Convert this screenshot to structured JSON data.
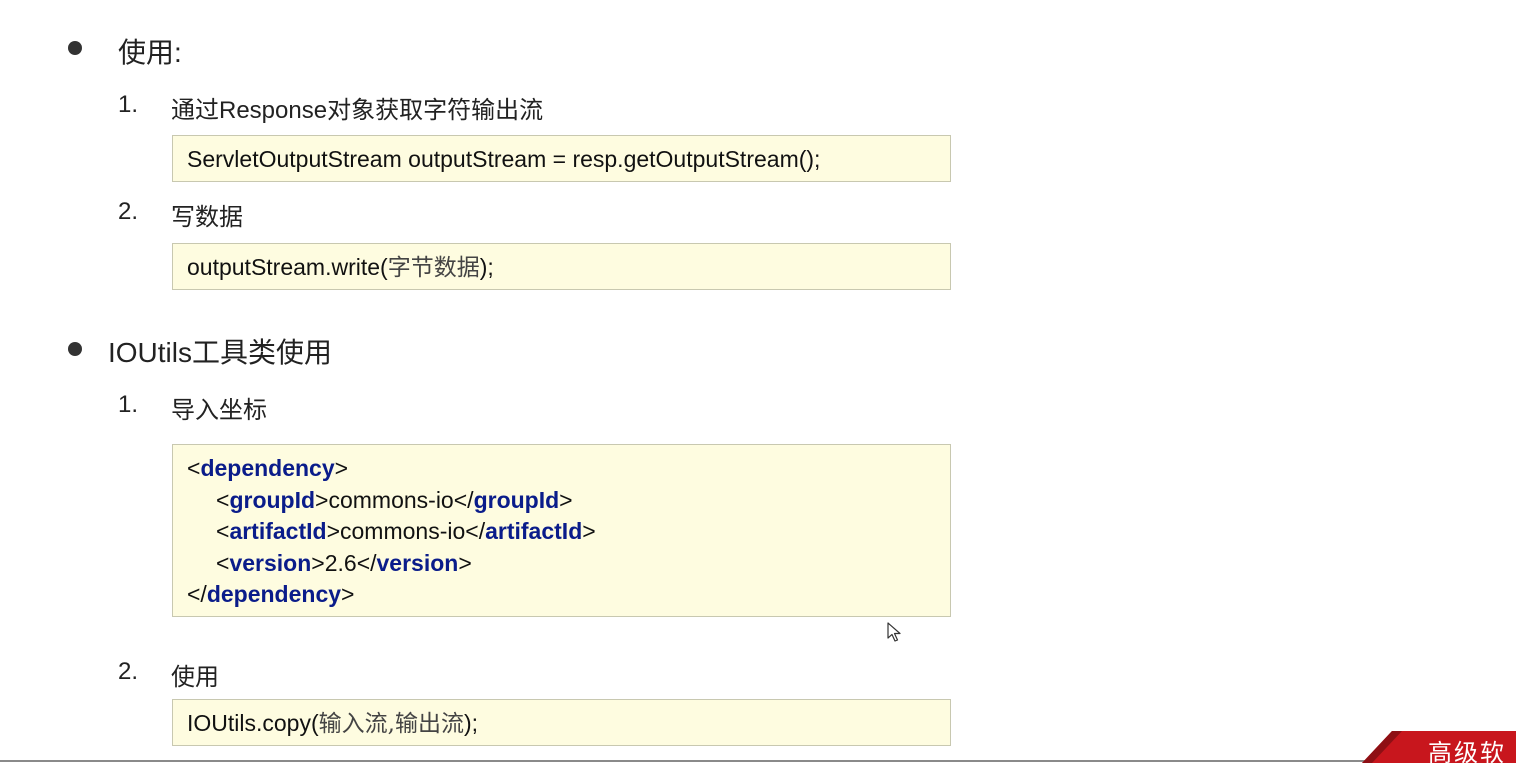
{
  "sections": [
    {
      "title": "使用:",
      "steps": [
        {
          "num": "1.",
          "label": "通过Response对象获取字符输出流",
          "code": "ServletOutputStream outputStream = resp.getOutputStream();"
        },
        {
          "num": "2.",
          "label": "写数据",
          "code_prefix": "outputStream.write(",
          "code_cn": "字节数据",
          "code_suffix": ");"
        }
      ]
    },
    {
      "title": "IOUtils工具类使用",
      "steps": [
        {
          "num": "1.",
          "label": "导入坐标",
          "xml": {
            "root_tag": "dependency",
            "group_tag": "groupId",
            "group_value": "commons-io",
            "artifact_tag": "artifactId",
            "artifact_value": "commons-io",
            "version_tag": "version",
            "version_value": "2.6"
          }
        },
        {
          "num": "2.",
          "label": "使用",
          "code_prefix": "IOUtils.copy(",
          "code_cn": "输入流,输出流",
          "code_suffix": ");"
        }
      ]
    }
  ],
  "logo_text": "高级软",
  "colors": {
    "code_bg": "#fefce0",
    "xml_tag": "#0a1c8a",
    "logo_red": "#c8161d"
  }
}
